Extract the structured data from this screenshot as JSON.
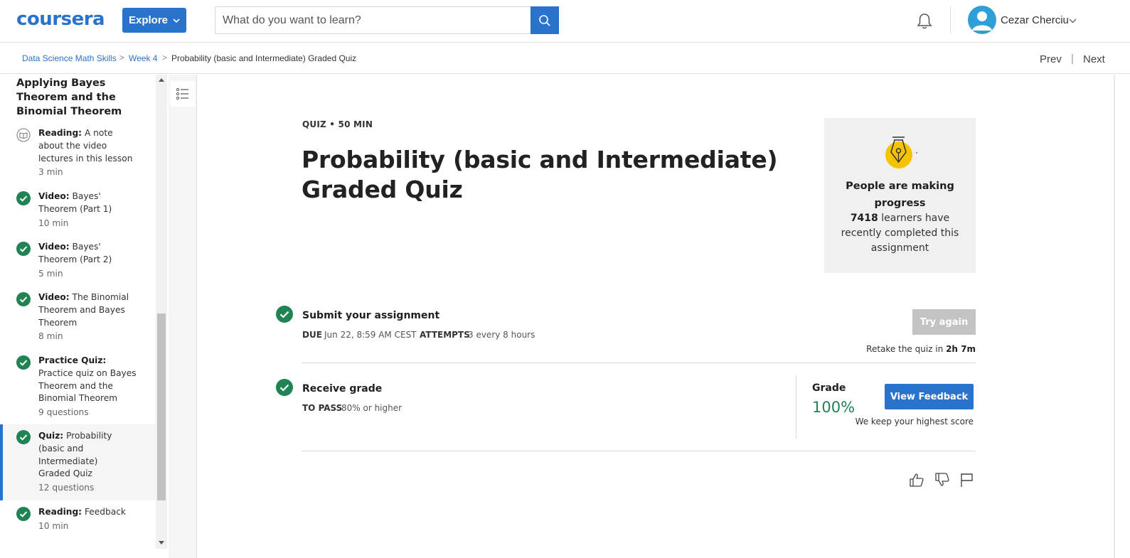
{
  "header": {
    "logo": "coursera",
    "explore_label": "Explore",
    "search_placeholder": "What do you want to learn?",
    "user_name": "Cezar Cherciu",
    "icons": [
      "search-icon",
      "bell-icon",
      "avatar-icon",
      "chevron-down-icon"
    ],
    "brand_color": "#2a73cc"
  },
  "breadcrumb": {
    "items": [
      "Data Science Math Skills",
      "Week 4",
      "Probability (basic and Intermediate) Graded Quiz"
    ],
    "separator": ">",
    "prev": "Prev",
    "next": "Next"
  },
  "sidebar": {
    "title": "Applying Bayes Theorem and the Binomial Theorem",
    "items": [
      {
        "type": "Reading:",
        "name": "A note about the video lectures in this lesson",
        "meta": "3 min",
        "icon": "book-icon",
        "completed": false
      },
      {
        "type": "Video:",
        "name": "Bayes' Theorem (Part 1)",
        "meta": "10 min",
        "icon": "check-circle-icon",
        "completed": true
      },
      {
        "type": "Video:",
        "name": "Bayes' Theorem (Part 2)",
        "meta": "5 min",
        "icon": "check-circle-icon",
        "completed": true
      },
      {
        "type": "Video:",
        "name": "The Binomial Theorem and Bayes Theorem",
        "meta": "8 min",
        "icon": "check-circle-icon",
        "completed": true
      },
      {
        "type": "Practice Quiz:",
        "name": "Practice quiz on Bayes Theorem and the Binomial Theorem",
        "meta": "9 questions",
        "icon": "check-circle-icon",
        "completed": true
      },
      {
        "type": "Quiz:",
        "name": "Probability (basic and Intermediate) Graded Quiz",
        "meta": "12 questions",
        "icon": "check-circle-icon",
        "completed": true,
        "active": true
      },
      {
        "type": "Reading:",
        "name": "Feedback",
        "meta": "10 min",
        "icon": "check-circle-icon",
        "completed": true
      }
    ]
  },
  "main": {
    "kicker": "QUIZ • 50 MIN",
    "title": "Probability (basic and Intermediate) Graded Quiz",
    "progress_card": {
      "heading": "People are making progress",
      "count": "7418",
      "text": "learners have recently completed this assignment"
    },
    "submit": {
      "title": "Submit your assignment",
      "due_label": "DUE",
      "due_value": "Jun 22, 8:59 AM CEST",
      "attempts_label": "ATTEMPTS",
      "attempts_value": "3 every 8 hours",
      "try_again": "Try again",
      "retake_prefix": "Retake the quiz in",
      "retake_time": "2h 7m"
    },
    "grade": {
      "title": "Receive grade",
      "pass_label": "TO PASS",
      "pass_value": "80% or higher",
      "grade_label": "Grade",
      "grade_value": "100%",
      "feedback_button": "View Feedback",
      "keep_note": "We keep your highest score"
    },
    "feedback_icons": [
      "thumbs-up-icon",
      "thumbs-down-icon",
      "flag-icon"
    ],
    "success_color": "#1f8354"
  }
}
